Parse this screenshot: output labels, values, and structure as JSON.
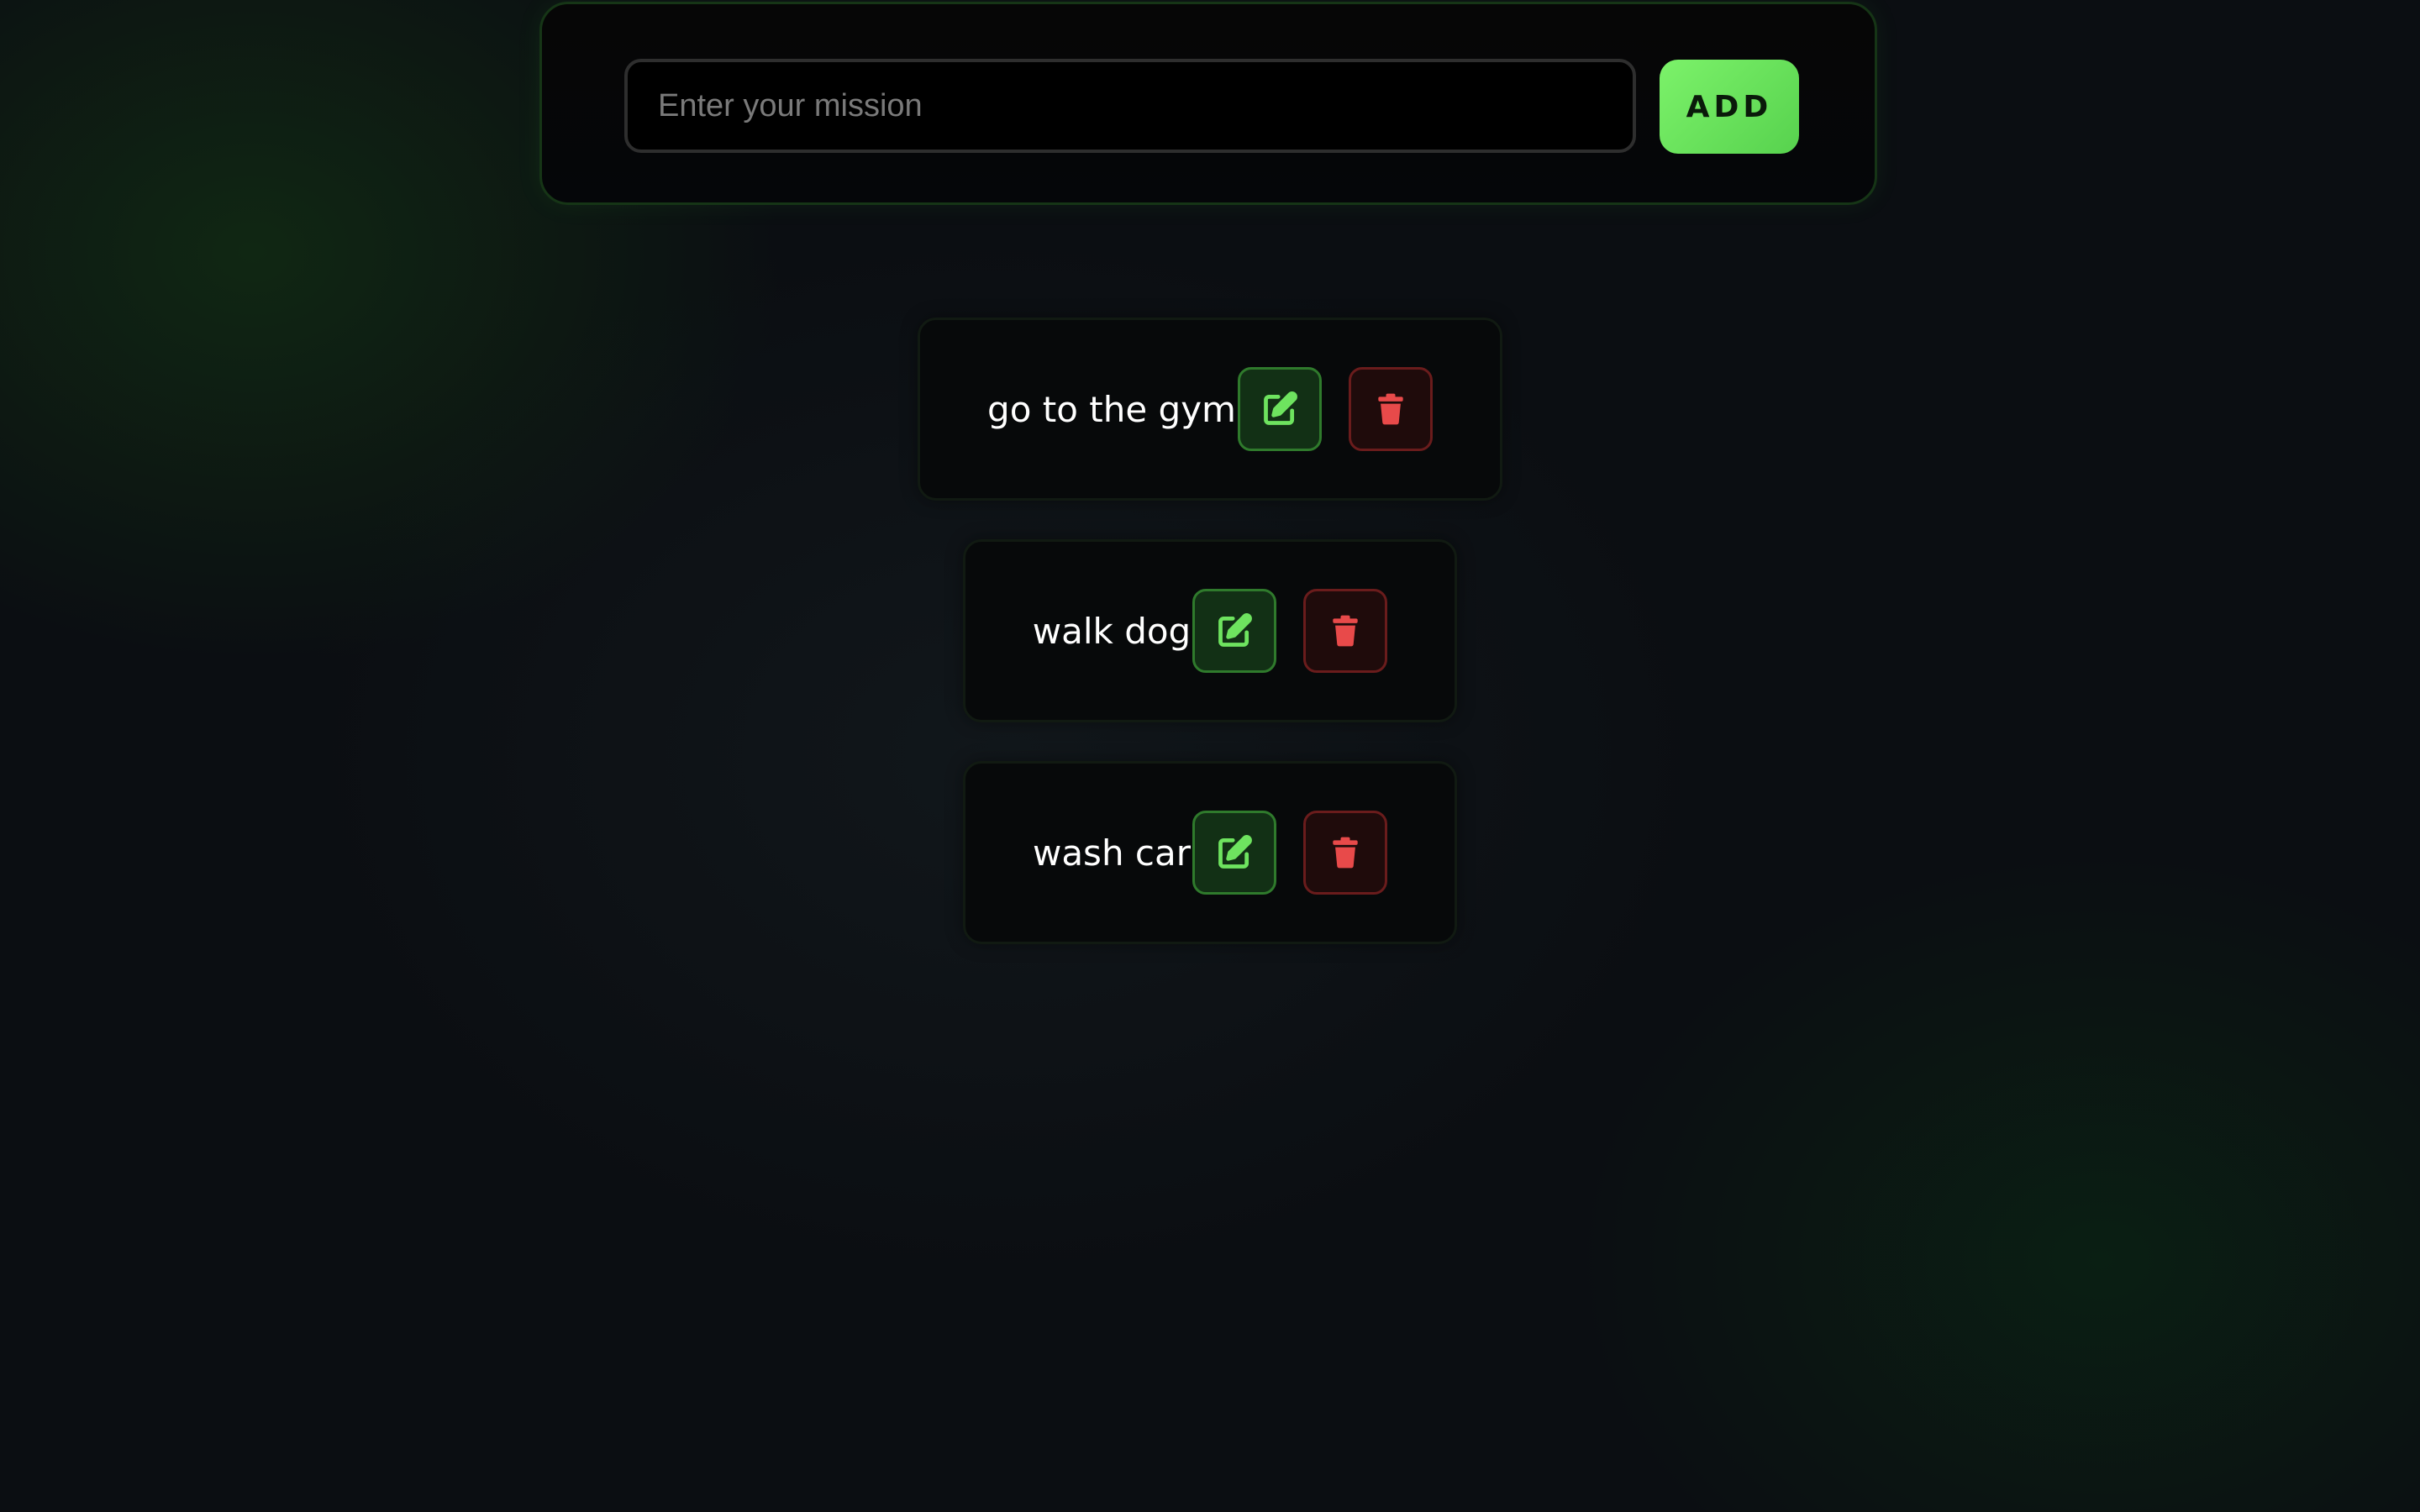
{
  "input_panel": {
    "placeholder": "Enter your mission",
    "value": "",
    "add_label": "ADD"
  },
  "todos": [
    {
      "text": "go to the gym",
      "edit_icon": "edit-icon",
      "delete_icon": "trash-icon"
    },
    {
      "text": "walk dog",
      "edit_icon": "edit-icon",
      "delete_icon": "trash-icon"
    },
    {
      "text": "wash car",
      "edit_icon": "edit-icon",
      "delete_icon": "trash-icon"
    }
  ],
  "colors": {
    "accent_green": "#6ee35f",
    "delete_red": "#e84a4a",
    "background": "#0b0e12"
  }
}
